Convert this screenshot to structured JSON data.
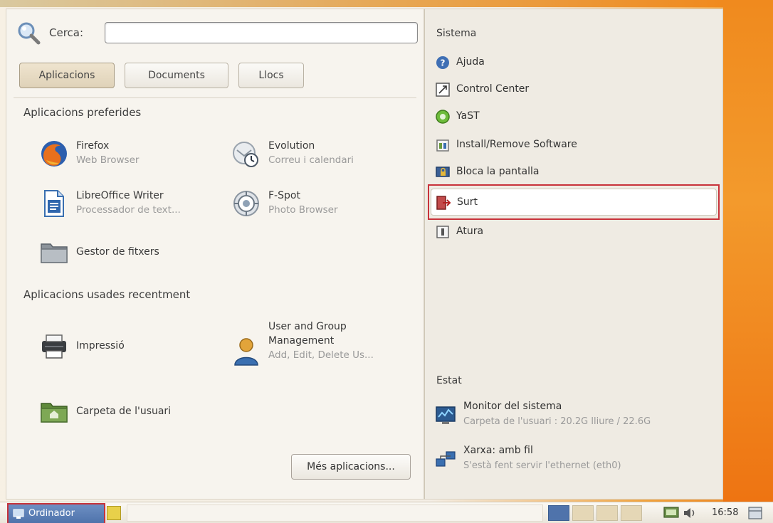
{
  "search": {
    "label": "Cerca:",
    "value": "",
    "placeholder": ""
  },
  "tabs": [
    {
      "label": "Aplicacions",
      "active": true
    },
    {
      "label": "Documents",
      "active": false
    },
    {
      "label": "Llocs",
      "active": false
    }
  ],
  "favorites": {
    "title": "Aplicacions preferides",
    "items": [
      {
        "name": "Firefox",
        "description": "Web Browser",
        "icon": "firefox-icon"
      },
      {
        "name": "Evolution",
        "description": "Correu i calendari",
        "icon": "evolution-icon"
      },
      {
        "name": "LibreOffice Writer",
        "description": "Processador de text...",
        "icon": "writer-icon"
      },
      {
        "name": "F-Spot",
        "description": "Photo Browser",
        "icon": "fspot-icon"
      },
      {
        "name": "Gestor de fitxers",
        "description": "",
        "icon": "folder-icon"
      }
    ]
  },
  "recent": {
    "title": "Aplicacions usades recentment",
    "items": [
      {
        "name": "Impressió",
        "description": "",
        "icon": "printer-icon"
      },
      {
        "name_line1": "User and Group",
        "name_line2": "Management",
        "description": "Add, Edit, Delete Us...",
        "icon": "user-icon"
      },
      {
        "name": "Carpeta de l'usuari",
        "description": "",
        "icon": "home-folder-icon"
      }
    ]
  },
  "more_button": "Més aplicacions...",
  "system": {
    "title": "Sistema",
    "items": [
      {
        "label": "Ajuda",
        "icon": "help-icon"
      },
      {
        "label": "Control Center",
        "icon": "control-center-icon"
      },
      {
        "label": "YaST",
        "icon": "yast-icon"
      },
      {
        "label": "Install/Remove Software",
        "icon": "install-icon"
      },
      {
        "label": "Bloca la pantalla",
        "icon": "lock-screen-icon"
      },
      {
        "label": "Surt",
        "icon": "logout-icon",
        "highlighted": true
      },
      {
        "label": "Atura",
        "icon": "shutdown-icon"
      }
    ]
  },
  "status": {
    "title": "Estat",
    "items": [
      {
        "name": "Monitor del sistema",
        "description": "Carpeta de l'usuari : 20.2G lliure / 22.6G",
        "icon": "system-monitor-icon"
      },
      {
        "name": "Xarxa: amb fil",
        "description": "S'està fent servir l'ethernet (eth0)",
        "icon": "network-icon"
      }
    ]
  },
  "taskbar": {
    "start_label": "Ordinador",
    "clock": "16:58"
  },
  "colors": {
    "highlight_border": "#c8323a",
    "start_button": "#5577ae",
    "desktop_orange": "#f08a1e"
  }
}
